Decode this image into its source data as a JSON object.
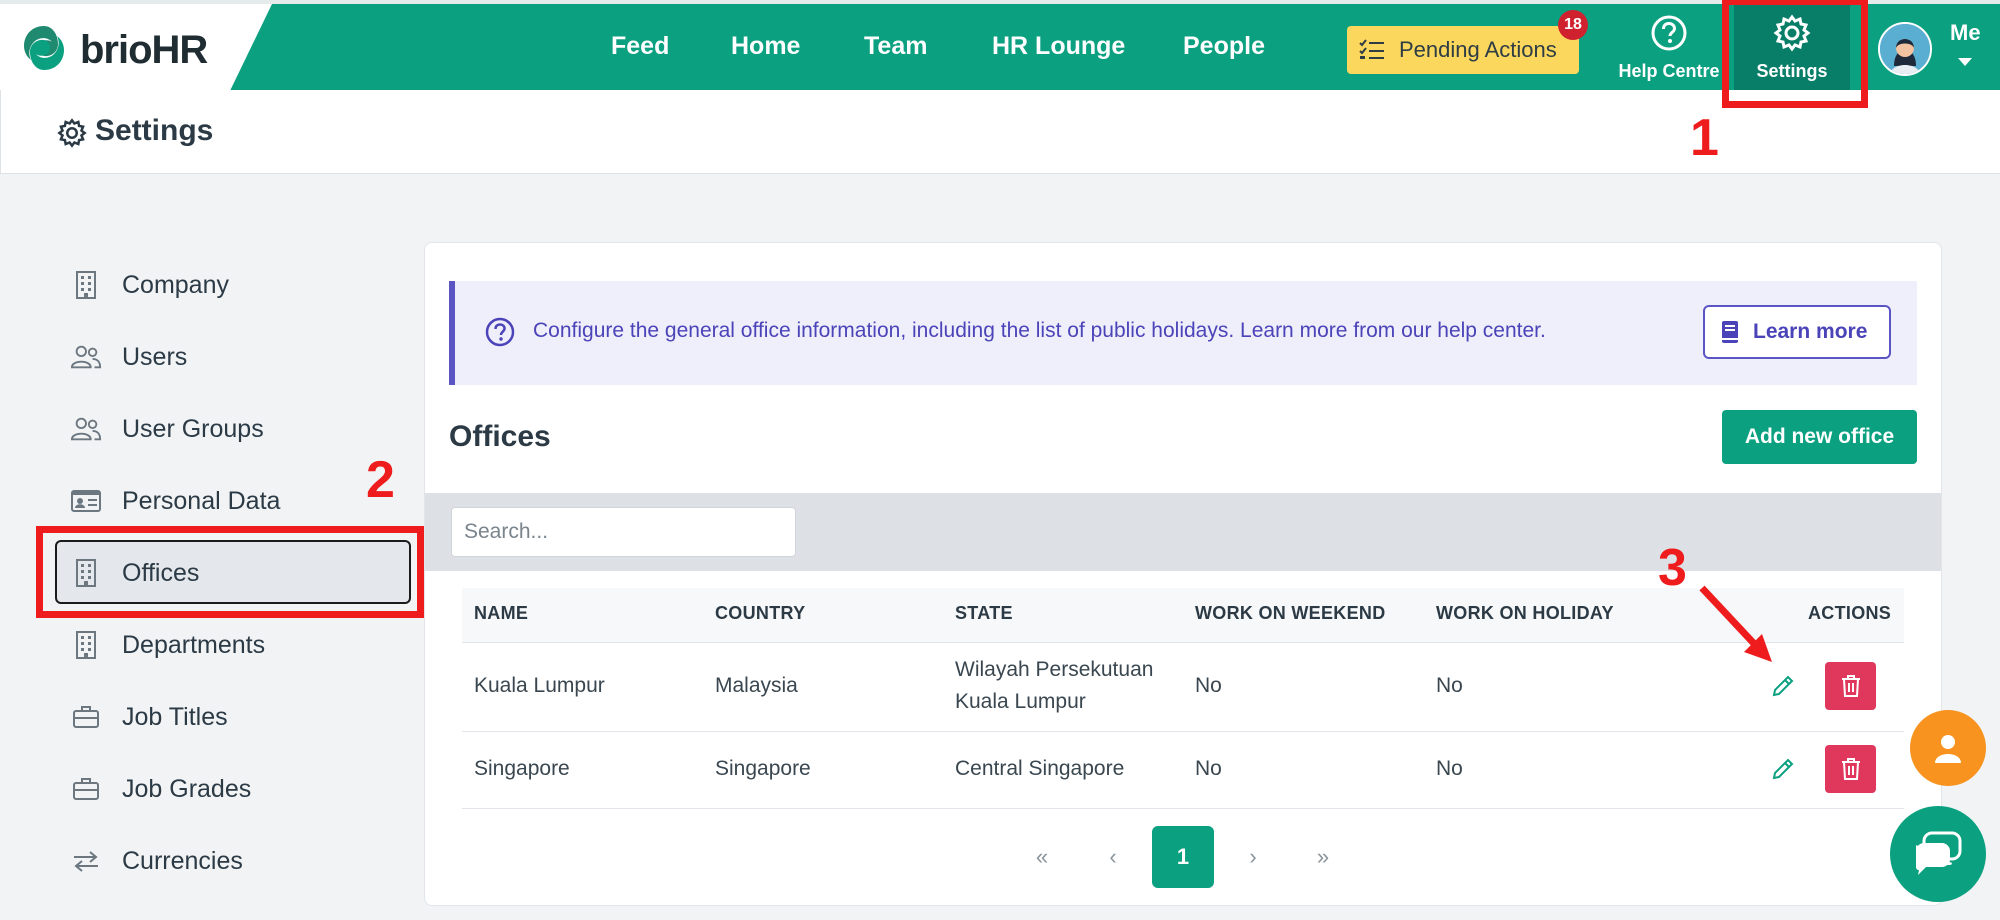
{
  "brand": {
    "name": "brio",
    "suffix": "HR"
  },
  "nav": {
    "links": [
      "Feed",
      "Home",
      "Team",
      "HR Lounge",
      "People"
    ],
    "pending_label": "Pending Actions",
    "pending_count": "18",
    "help_label": "Help Centre",
    "settings_label": "Settings",
    "user_label": "Me"
  },
  "page": {
    "title": "Settings"
  },
  "sidebar": {
    "items": [
      {
        "label": "Company",
        "icon": "building-icon"
      },
      {
        "label": "Users",
        "icon": "users-icon"
      },
      {
        "label": "User Groups",
        "icon": "users-icon"
      },
      {
        "label": "Personal Data",
        "icon": "id-card-icon"
      },
      {
        "label": "Offices",
        "icon": "building-icon",
        "active": true
      },
      {
        "label": "Departments",
        "icon": "building-icon"
      },
      {
        "label": "Job Titles",
        "icon": "briefcase-icon"
      },
      {
        "label": "Job Grades",
        "icon": "briefcase-icon"
      },
      {
        "label": "Currencies",
        "icon": "exchange-icon"
      }
    ]
  },
  "info": {
    "text": "Configure the general office information, including the list of public holidays. Learn more from our help center.",
    "learn_more": "Learn more"
  },
  "offices": {
    "title": "Offices",
    "add_button": "Add new office",
    "search_placeholder": "Search...",
    "columns": [
      "NAME",
      "COUNTRY",
      "STATE",
      "WORK ON WEEKEND",
      "WORK ON HOLIDAY",
      "ACTIONS"
    ],
    "rows": [
      {
        "name": "Kuala Lumpur",
        "country": "Malaysia",
        "state_line1": "Wilayah Persekutuan",
        "state_line2": "Kuala Lumpur",
        "weekend": "No",
        "holiday": "No"
      },
      {
        "name": "Singapore",
        "country": "Singapore",
        "state_line1": "Central Singapore",
        "state_line2": "",
        "weekend": "No",
        "holiday": "No"
      }
    ],
    "pagination": {
      "first": "«",
      "prev": "‹",
      "current": "1",
      "next": "›",
      "last": "»"
    }
  },
  "annotations": [
    "1",
    "2",
    "3"
  ],
  "colors": {
    "brand": "#0aa080",
    "annotation": "#ee1c1c",
    "info": "#4b44b8",
    "danger": "#e0385c",
    "pending": "#fbd85d"
  }
}
